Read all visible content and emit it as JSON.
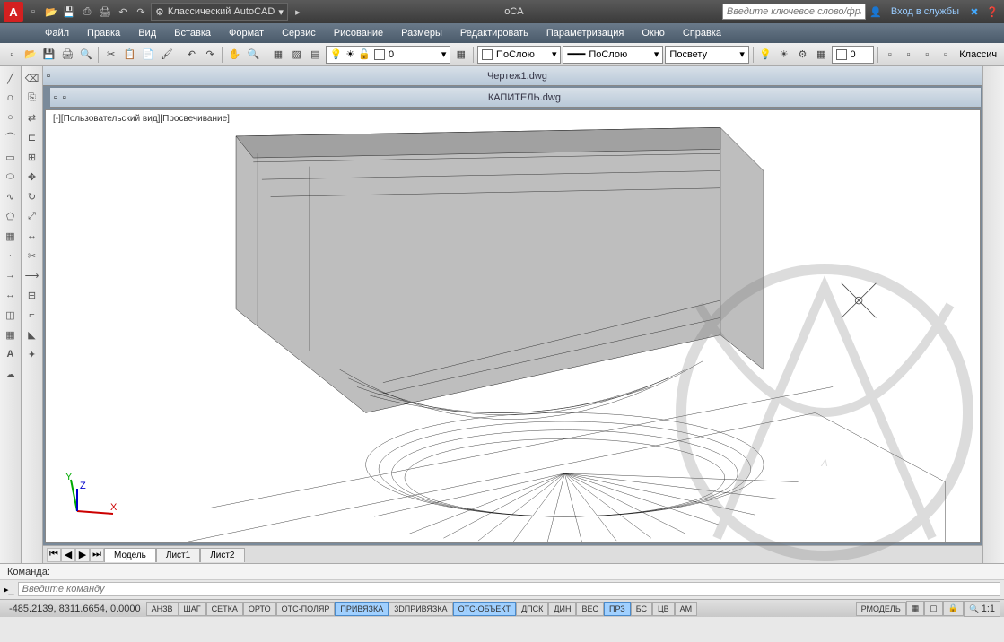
{
  "titlebar": {
    "workspace": "Классический AutoCAD",
    "app_center": "oCA",
    "search_placeholder": "Введите ключевое слово/фразу",
    "login": "Вход в службы"
  },
  "menu": {
    "items": [
      "Файл",
      "Правка",
      "Вид",
      "Вставка",
      "Формат",
      "Сервис",
      "Рисование",
      "Размеры",
      "Редактировать",
      "Параметризация",
      "Окно",
      "Справка"
    ]
  },
  "props": {
    "layer": "ПоСлою",
    "linetype": "ПоСлою",
    "lineweight": "Посвету",
    "misc": "0",
    "ws_right": "Классич"
  },
  "docs": {
    "doc1_title": "Чертеж1.dwg",
    "doc2_title": "КАПИТЕЛЬ.dwg",
    "view_label": "[-][Пользовательский вид][Просвечивание]"
  },
  "model_tabs": {
    "t1": "Модель",
    "t2": "Лист1",
    "t3": "Лист2"
  },
  "cmd": {
    "history": "Команда:",
    "placeholder": "Введите команду"
  },
  "status": {
    "coords": "-485.2139, 8311.6654, 0.0000",
    "btns": [
      "АНЗВ",
      "ШАГ",
      "СЕТКА",
      "ОРТО",
      "ОТС-ПОЛЯР",
      "ПРИВЯЗКА",
      "3DПРИВЯЗКА",
      "ОТС-ОБЪЕКТ",
      "ДПСК",
      "ДИН",
      "ВЕС",
      "ПРЗ",
      "БС",
      "ЦВ",
      "АМ"
    ],
    "active": [
      5,
      7,
      11
    ],
    "model": "РМОДЕЛЬ",
    "scale": "1:1"
  }
}
